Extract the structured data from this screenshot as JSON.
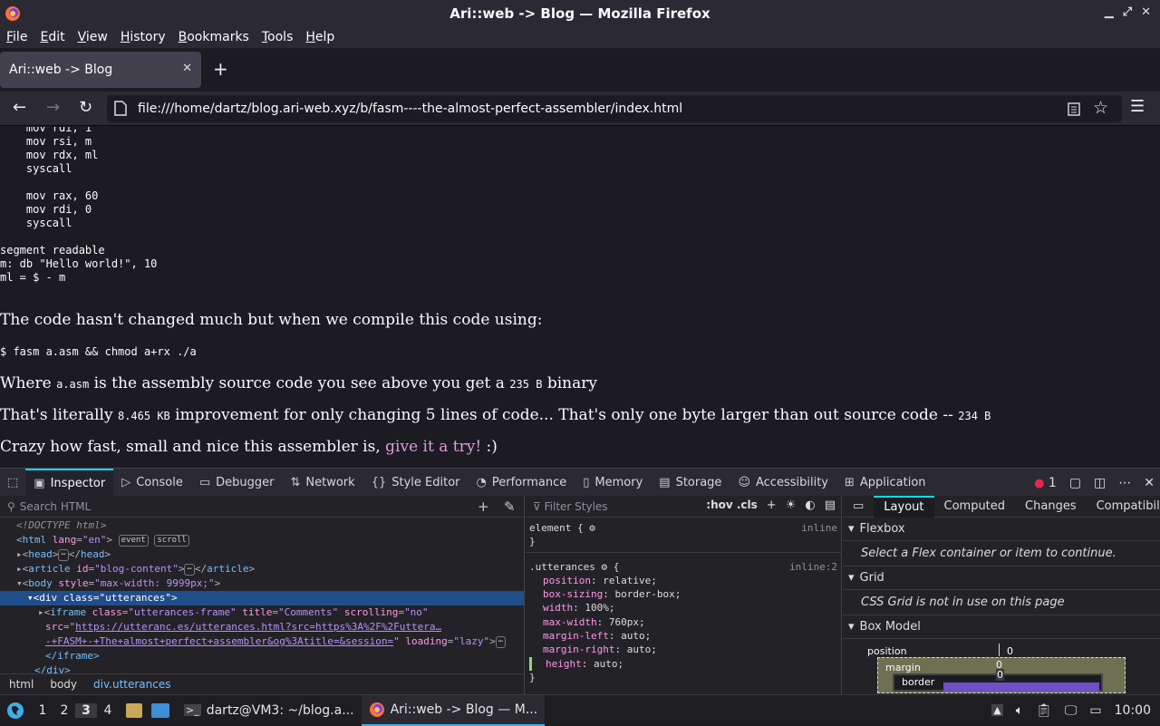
{
  "window": {
    "title": "Ari::web -> Blog — Mozilla Firefox"
  },
  "menu": [
    "File",
    "Edit",
    "View",
    "History",
    "Bookmarks",
    "Tools",
    "Help"
  ],
  "tab": {
    "label": "Ari::web -> Blog"
  },
  "url": "file:///home/dartz/blog.ari-web.xyz/b/fasm----the-almost-perfect-assembler/index.html",
  "code_block": "    mov rdi, 1\n    mov rsi, m\n    mov rdx, ml\n    syscall\n\n    mov rax, 60\n    mov rdi, 0\n    syscall\n\nsegment readable\nm: db \"Hello world!\", 10\nml = $ - m",
  "p1": "The code hasn't changed much but when we compile this code using:",
  "cmd": "$ fasm a.asm && chmod a+rx ./a",
  "p2": {
    "a": "Where ",
    "b": "a.asm",
    "c": " is the assembly source code you see above you get a ",
    "d": "235 B",
    "e": " binary"
  },
  "p3": {
    "a": "That's literally ",
    "b": "8.465 KB",
    "c": " improvement for only changing 5 lines of code... That's only one byte larger than out source code -- ",
    "d": "234 B"
  },
  "p4": {
    "a": "Crazy how fast, small and nice this assembler is, ",
    "link": "give it a try!",
    "c": " :)"
  },
  "devtools": {
    "tabs": [
      "Inspector",
      "Console",
      "Debugger",
      "Network",
      "Style Editor",
      "Performance",
      "Memory",
      "Storage",
      "Accessibility",
      "Application"
    ],
    "error_count": "1",
    "search_placeholder": "Search HTML",
    "filter_placeholder": "Filter Styles",
    "hov_cls": ":hov .cls",
    "layout_tabs": [
      "Layout",
      "Computed",
      "Changes",
      "Compatibility"
    ],
    "breadcrumb": [
      "html",
      "body",
      "div.utterances"
    ],
    "tree": {
      "doctype": "<!DOCTYPE html>",
      "html": "html",
      "lang_attr": "lang",
      "lang_val": "\"en\"",
      "badge_event": "event",
      "badge_scroll": "scroll",
      "head": "head",
      "article": "article",
      "id_attr": "id",
      "id_val": "\"blog-content\"",
      "body": "body",
      "style_attr": "style",
      "style_val": "\"max-width: 9999px;\"",
      "div": "div",
      "class_attr": "class",
      "class_val": "\"utterances\"",
      "iframe": "iframe",
      "iframe_class_val": "\"utterances-frame\"",
      "title_attr": "title",
      "title_val": "\"Comments\"",
      "scrolling_attr": "scrolling",
      "scrolling_val": "\"no\"",
      "src_attr": "src",
      "src_val1": "https://utteranc.es/utterances.html?src=https%3A%2F%2Futtera…",
      "src_val2": "-+FASM+-+The+almost+perfect+assembler&og%3Atitle=&session=",
      "loading_attr": "loading",
      "loading_val": "\"lazy\"",
      "iframe_close": "</iframe>",
      "div_close": "</div>"
    },
    "rules": {
      "element": "element {",
      "element_src": "inline",
      "selector": ".utterances",
      "selector_src": "inline:2",
      "props": [
        {
          "name": "position",
          "value": "relative;"
        },
        {
          "name": "box-sizing",
          "value": "border-box;"
        },
        {
          "name": "width",
          "value": "100%;"
        },
        {
          "name": "max-width",
          "value": "760px;"
        },
        {
          "name": "margin-left",
          "value": "auto;"
        },
        {
          "name": "margin-right",
          "value": "auto;"
        },
        {
          "name": "height",
          "value": "auto;"
        }
      ]
    },
    "layout": {
      "flexbox": "Flexbox",
      "flexbox_msg": "Select a Flex container or item to continue.",
      "grid": "Grid",
      "grid_msg": "CSS Grid is not in use on this page",
      "boxmodel": "Box Model",
      "position_label": "position",
      "position_val": "0",
      "margin_label": "margin",
      "margin_val": "0",
      "border_label": "border",
      "border_val": "0"
    }
  },
  "taskbar": {
    "workspaces": [
      "1",
      "2",
      "3",
      "4"
    ],
    "terminal": "dartz@VM3: ~/blog.a...",
    "browser": "Ari::web -> Blog — M...",
    "clock": "10:00"
  },
  "colors": {
    "accent": "#00ddff",
    "link": "#e29cd7",
    "selection": "#204e8a"
  }
}
